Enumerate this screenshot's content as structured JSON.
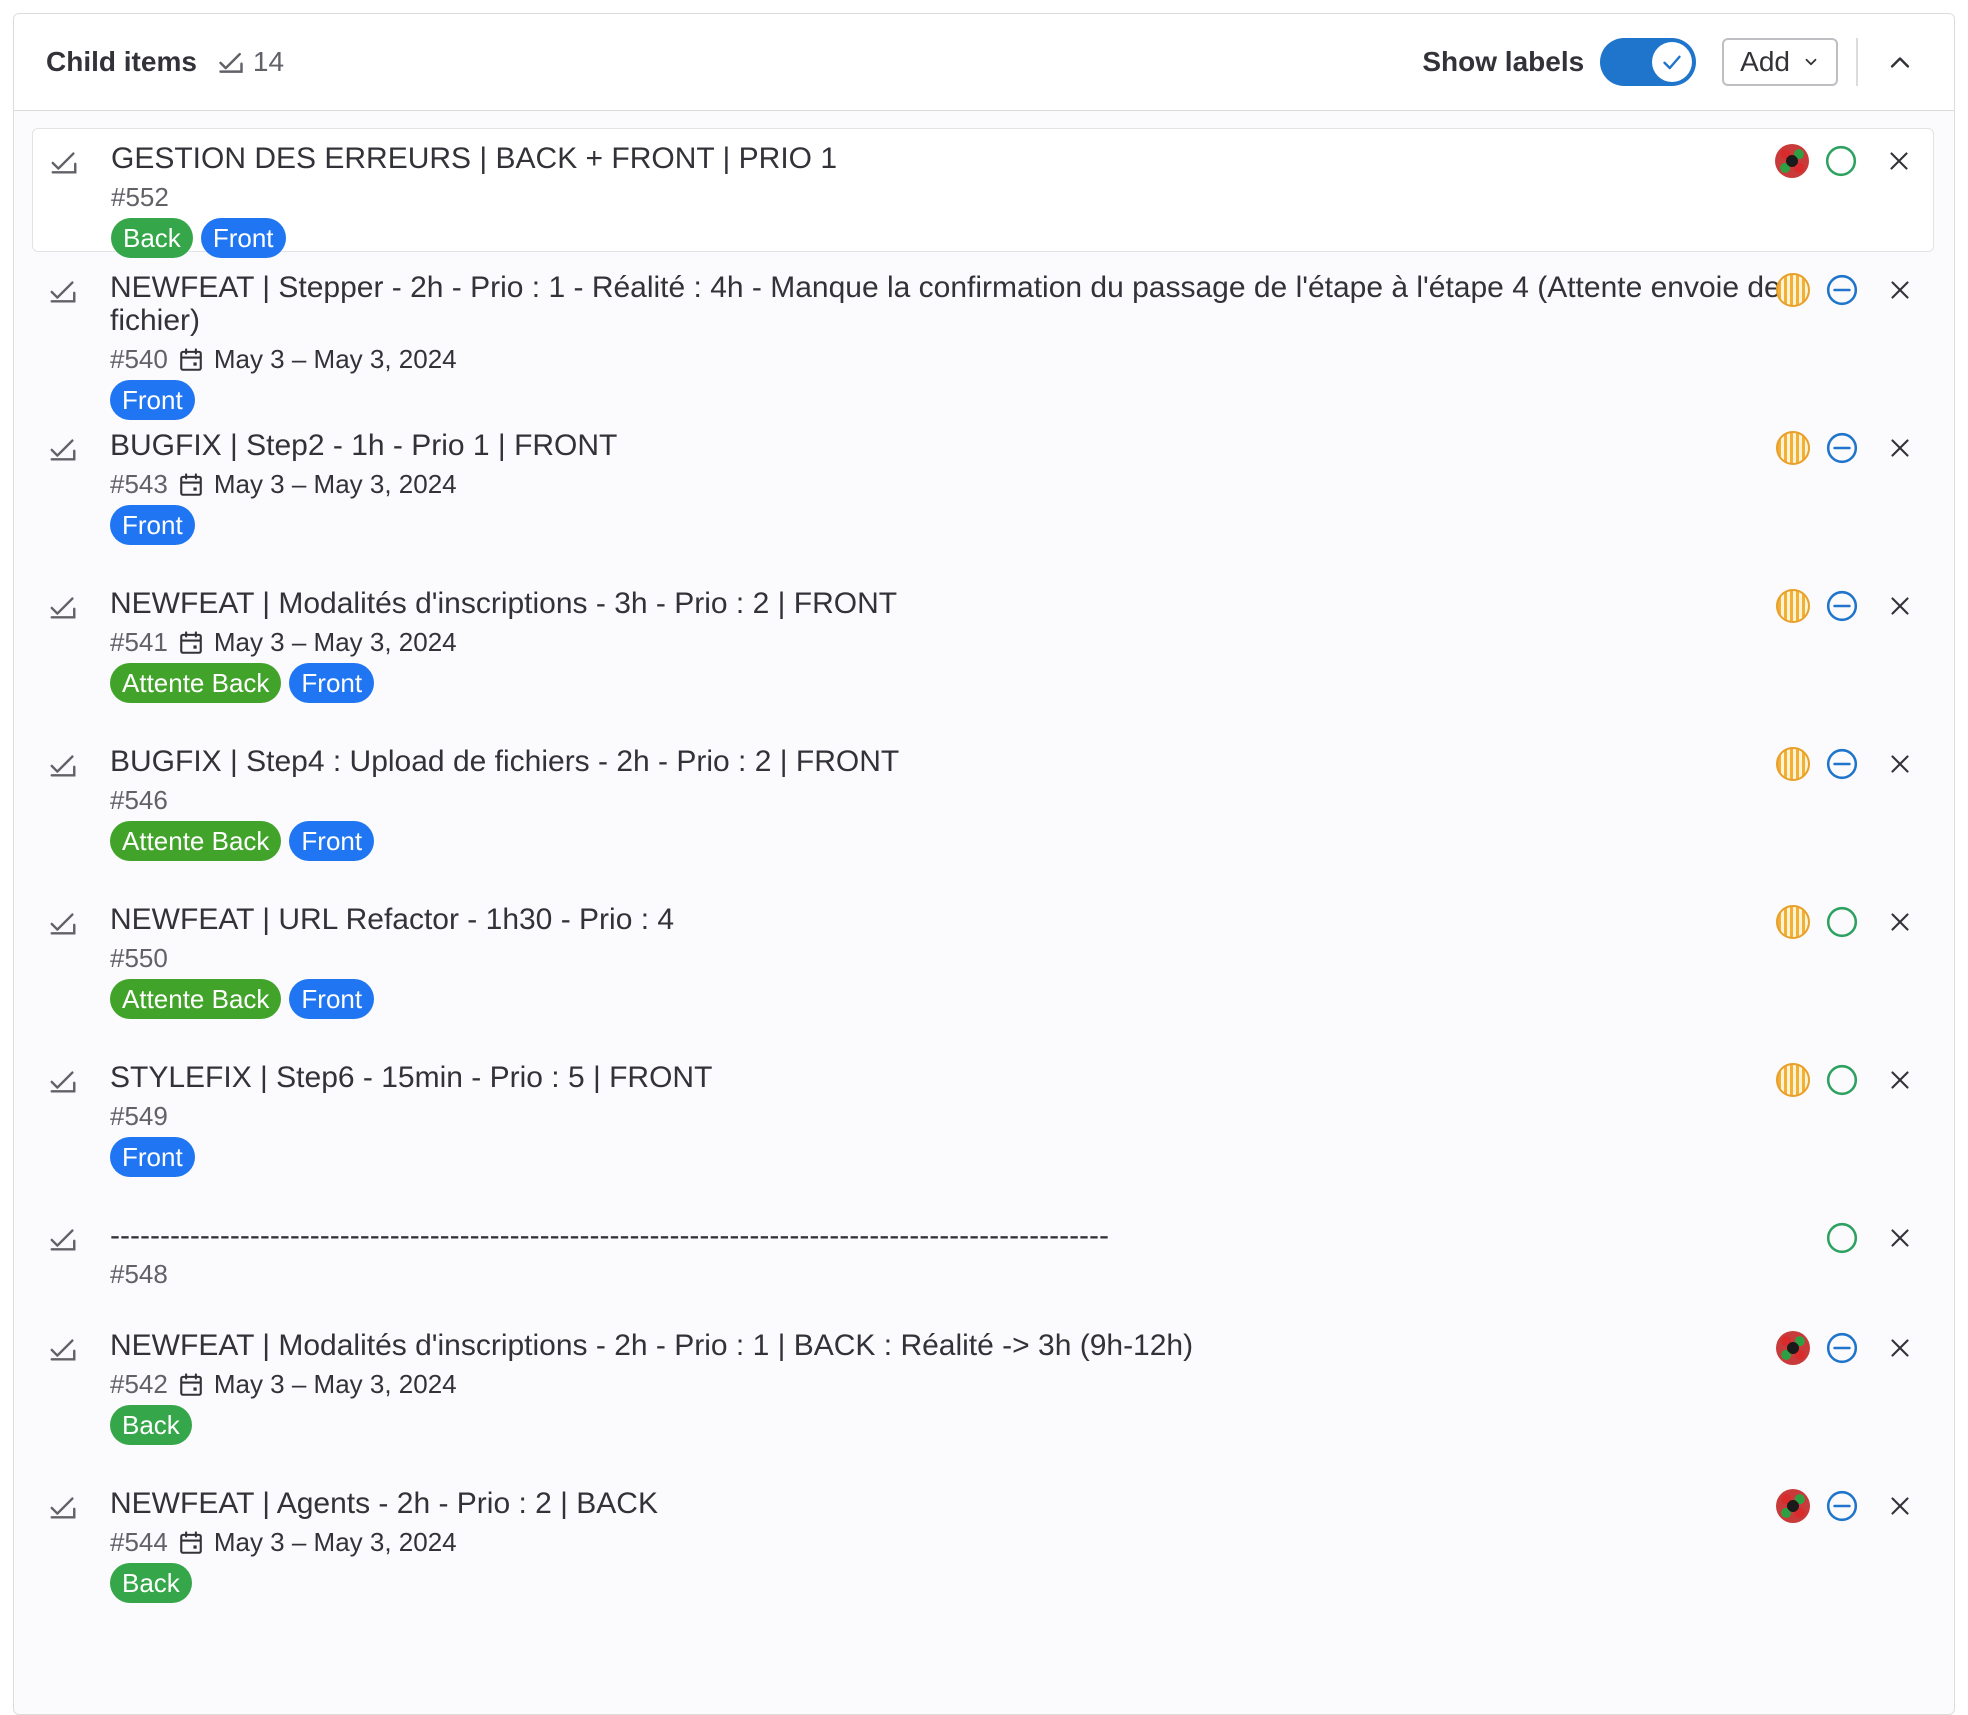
{
  "header": {
    "title": "Child items",
    "count": "14",
    "show_labels": "Show labels",
    "toggle_on": true,
    "add_label": "Add"
  },
  "colors": {
    "accent": "#1f75cb",
    "label_back": "#35a64a",
    "label_front": "#1f75f2",
    "label_attente": "#42a32a",
    "status_open": "#2da160",
    "status_blocked": "#1f75cb"
  },
  "items": [
    {
      "title": "GESTION DES ERREURS | BACK + FRONT | PRIO 1",
      "iid": "#552",
      "dates": "",
      "labels": [
        {
          "text": "Back",
          "kind": "back"
        },
        {
          "text": "Front",
          "kind": "front"
        }
      ],
      "assignee": "red",
      "status": "open-circle-icon"
    },
    {
      "title": "NEWFEAT | Stepper - 2h - Prio : 1 - Réalité : 4h - Manque la confirmation du passage de l'étape à l'étape 4 (Attente envoie de fichier)",
      "iid": "#540",
      "dates": "May 3 – May 3, 2024",
      "labels": [
        {
          "text": "Front",
          "kind": "front"
        }
      ],
      "assignee": "yellow",
      "status": "minus-circle-icon"
    },
    {
      "title": "BUGFIX | Step2 - 1h - Prio 1 | FRONT",
      "iid": "#543",
      "dates": "May 3 – May 3, 2024",
      "labels": [
        {
          "text": "Front",
          "kind": "front"
        }
      ],
      "assignee": "yellow",
      "status": "minus-circle-icon"
    },
    {
      "title": "NEWFEAT | Modalités d'inscriptions - 3h - Prio : 2 | FRONT",
      "iid": "#541",
      "dates": "May 3 – May 3, 2024",
      "labels": [
        {
          "text": "Attente Back",
          "kind": "attente"
        },
        {
          "text": "Front",
          "kind": "front"
        }
      ],
      "assignee": "yellow",
      "status": "minus-circle-icon"
    },
    {
      "title": "BUGFIX | Step4 : Upload de fichiers - 2h - Prio : 2 | FRONT",
      "iid": "#546",
      "dates": "",
      "labels": [
        {
          "text": "Attente Back",
          "kind": "attente"
        },
        {
          "text": "Front",
          "kind": "front"
        }
      ],
      "assignee": "yellow",
      "status": "minus-circle-icon"
    },
    {
      "title": "NEWFEAT | URL Refactor - 1h30 - Prio : 4",
      "iid": "#550",
      "dates": "",
      "labels": [
        {
          "text": "Attente Back",
          "kind": "attente"
        },
        {
          "text": "Front",
          "kind": "front"
        }
      ],
      "assignee": "yellow",
      "status": "open-circle-icon"
    },
    {
      "title": "STYLEFIX | Step6 - 15min - Prio : 5 | FRONT",
      "iid": "#549",
      "dates": "",
      "labels": [
        {
          "text": "Front",
          "kind": "front"
        }
      ],
      "assignee": "yellow",
      "status": "open-circle-icon"
    },
    {
      "title": "----------------------------------------------------------------------------------------------------",
      "iid": "#548",
      "dates": "",
      "labels": [],
      "assignee": "none",
      "status": "open-circle-icon"
    },
    {
      "title": "NEWFEAT | Modalités d'inscriptions - 2h - Prio : 1 | BACK : Réalité -> 3h (9h-12h)",
      "iid": "#542",
      "dates": "May 3 – May 3, 2024",
      "labels": [
        {
          "text": "Back",
          "kind": "back"
        }
      ],
      "assignee": "red",
      "status": "minus-circle-icon"
    },
    {
      "title": "NEWFEAT | Agents - 2h - Prio : 2 | BACK",
      "iid": "#544",
      "dates": "May 3 – May 3, 2024",
      "labels": [
        {
          "text": "Back",
          "kind": "back"
        }
      ],
      "assignee": "red",
      "status": "minus-circle-icon"
    }
  ]
}
